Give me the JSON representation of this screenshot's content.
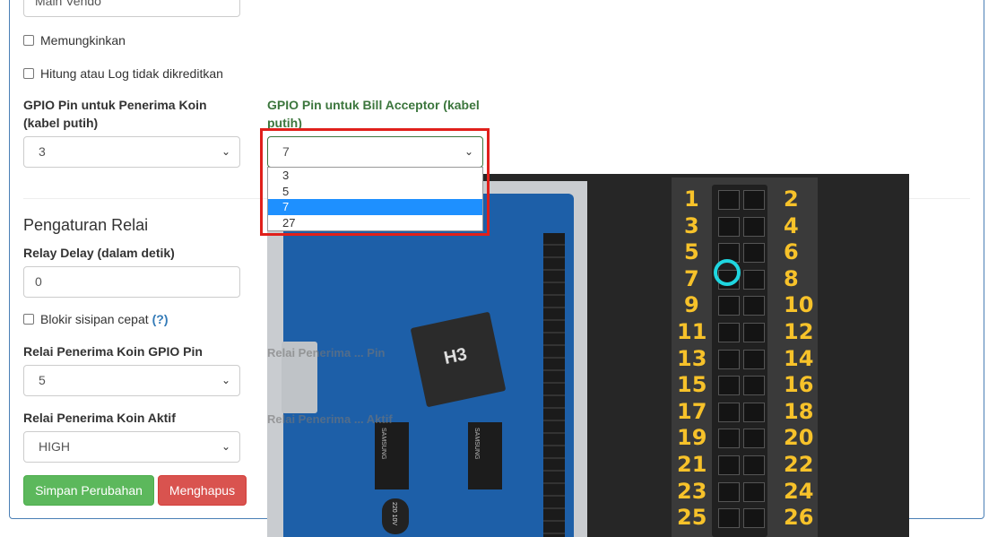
{
  "form": {
    "top_input_value": "Main Vendo",
    "enable_label": "Memungkinkan",
    "no_credit_label": "Hitung atau Log tidak dikreditkan",
    "coin_pin_label": "GPIO Pin untuk Penerima Koin (kabel putih)",
    "coin_pin_value": "3",
    "bill_pin_label": "GPIO Pin untuk Bill Acceptor (kabel putih)",
    "bill_pin_value": "7",
    "bill_pin_options": [
      "3",
      "5",
      "7",
      "27"
    ],
    "bill_pin_selected_index": 2
  },
  "relay": {
    "heading": "Pengaturan Relai",
    "delay_label": "Relay Delay (dalam detik)",
    "delay_value": "0",
    "block_label": "Blokir sisipan cepat",
    "help_glyph": "(?)",
    "coin_relay_pin_label": "Relai Penerima Koin GPIO Pin",
    "coin_relay_pin_value": "5",
    "coin_relay_active_label": "Relai Penerima Koin Aktif",
    "coin_relay_active_value": "HIGH",
    "ghost_pin_label": "Relai Penerima ... Pin",
    "ghost_active_label": "Relai Penerima ... Aktif"
  },
  "buttons": {
    "save": "Simpan Perubahan",
    "delete": "Menghapus"
  },
  "pin_diagram": {
    "odd": [
      "1",
      "3",
      "5",
      "7",
      "9",
      "11",
      "13",
      "15",
      "17",
      "19",
      "21",
      "23",
      "25"
    ],
    "even": [
      "2",
      "4",
      "6",
      "8",
      "10",
      "12",
      "14",
      "16",
      "18",
      "20",
      "22",
      "24",
      "26"
    ],
    "highlighted_pin": "7",
    "chip_labels": [
      "H3",
      "SAMSUNG",
      "SAMSUNG",
      "220 10V"
    ]
  },
  "colors": {
    "panel_border": "#4a7fb5",
    "save_green": "#5cb85c",
    "delete_red": "#d9534f",
    "highlight_red": "#e0201b",
    "pin_number_yellow": "#f7c22a",
    "highlight_cyan": "#1fd6e0",
    "selected_blue": "#1e90ff"
  }
}
